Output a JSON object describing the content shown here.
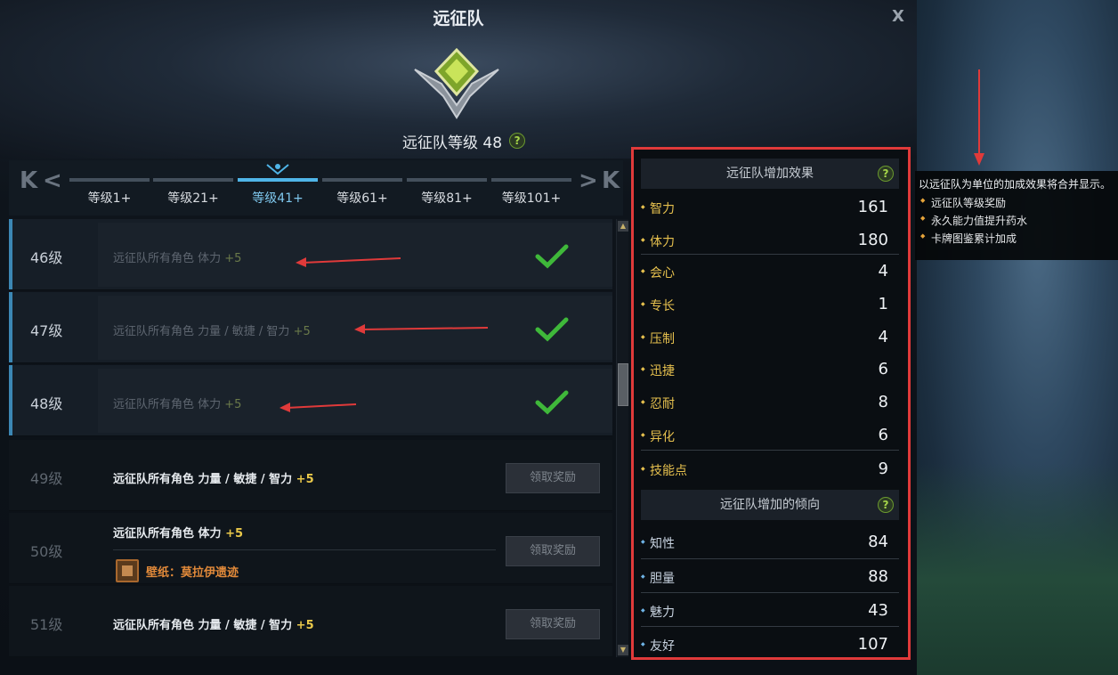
{
  "window": {
    "title": "远征队",
    "close_label": "X",
    "level_text": "远征队等级 48",
    "help_label": "?"
  },
  "tabs": [
    {
      "label": "等级1+",
      "active": false
    },
    {
      "label": "等级21+",
      "active": false
    },
    {
      "label": "等级41+",
      "active": true
    },
    {
      "label": "等级61+",
      "active": false
    },
    {
      "label": "等级81+",
      "active": false
    },
    {
      "label": "等级101+",
      "active": false
    }
  ],
  "nav": {
    "first": "K",
    "prev": "<",
    "next": ">",
    "last": "K"
  },
  "levels": [
    {
      "level": "46级",
      "desc": "远征队所有角色 体力",
      "plus": "+5",
      "status": "claimed"
    },
    {
      "level": "47级",
      "desc": "远征队所有角色 力量 / 敏捷 / 智力",
      "plus": "+5",
      "status": "claimed"
    },
    {
      "level": "48级",
      "desc": "远征队所有角色 体力",
      "plus": "+5",
      "status": "claimed"
    },
    {
      "level": "49级",
      "desc": "远征队所有角色 力量 / 敏捷 / 智力",
      "plus": "+5",
      "status": "open",
      "button": "领取奖励"
    },
    {
      "level": "50级",
      "desc": "远征队所有角色 体力",
      "plus": "+5",
      "status": "open",
      "button": "领取奖励",
      "extra": "壁纸：莫拉伊遗迹"
    },
    {
      "level": "51级",
      "desc": "远征队所有角色 力量 / 敏捷 / 智力",
      "plus": "+5",
      "status": "open",
      "button": "领取奖励"
    }
  ],
  "stats_panel": {
    "effects_header": "远征队增加效果",
    "effects": [
      {
        "name": "智力",
        "value": "161"
      },
      {
        "name": "体力",
        "value": "180"
      },
      {
        "name": "会心",
        "value": "4"
      },
      {
        "name": "专长",
        "value": "1"
      },
      {
        "name": "压制",
        "value": "4"
      },
      {
        "name": "迅捷",
        "value": "6"
      },
      {
        "name": "忍耐",
        "value": "8"
      },
      {
        "name": "异化",
        "value": "6"
      },
      {
        "name": "技能点",
        "value": "9"
      }
    ],
    "tendency_header": "远征队增加的倾向",
    "tendencies": [
      {
        "name": "知性",
        "value": "84"
      },
      {
        "name": "胆量",
        "value": "88"
      },
      {
        "name": "魅力",
        "value": "43"
      },
      {
        "name": "友好",
        "value": "107"
      }
    ]
  },
  "tooltip": {
    "title": "以远征队为单位的加成效果将合并显示。",
    "items": [
      "远征队等级奖励",
      "永久能力值提升药水",
      "卡牌图鉴累计加成"
    ]
  },
  "colors": {
    "accent_blue": "#4fb5e8",
    "highlight_red": "#e03a3a",
    "gold": "#e6c04e",
    "check_green": "#3fb83a"
  }
}
